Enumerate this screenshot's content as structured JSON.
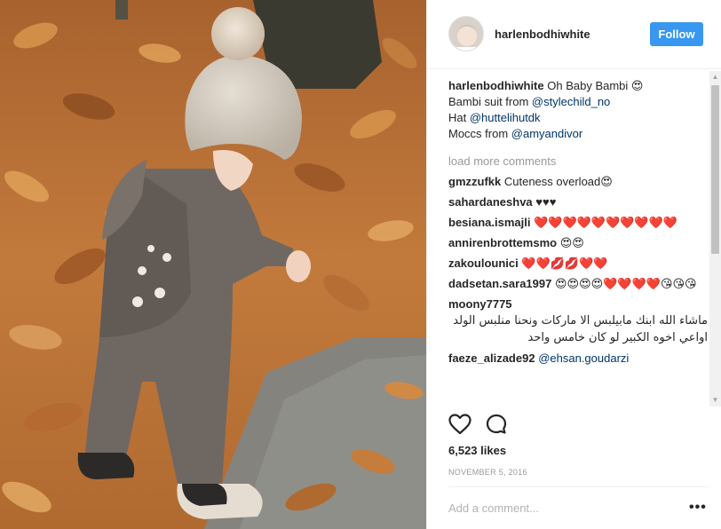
{
  "post": {
    "username": "harlenbodhiwhite",
    "follow_label": "Follow",
    "caption": {
      "user": "harlenbodhiwhite",
      "line1_text": "Oh Baby Bambi 😍",
      "line2_prefix": "Bambi suit from ",
      "line2_mention": "@stylechild_no",
      "line3_prefix": "Hat ",
      "line3_mention": "@huttelihutdk",
      "line4_prefix": "Moccs from ",
      "line4_mention": "@amyandivor"
    },
    "load_more_label": "load more comments",
    "comments": [
      {
        "user": "gmzzufkk",
        "text": "Cuteness overload😍"
      },
      {
        "user": "sahardaneshva",
        "text": "♥♥♥"
      },
      {
        "user": "besiana.ismajli",
        "text": "❤️❤️❤️❤️❤️❤️❤️❤️❤️❤️"
      },
      {
        "user": "annirenbrottemsmo",
        "text": "😍😍"
      },
      {
        "user": "zakoulounici",
        "text": "❤️❤️💋💋❤️❤️"
      },
      {
        "user": "dadsetan.sara1997",
        "text": "😍😍😍😍❤️❤️❤️❤️😘😘😘"
      },
      {
        "user": "moony7775",
        "text": "ماشاء الله ابنك مابيلبس الا ماركات ونحنا منلبس الولد اواعي اخوه الكبير لو كان خامس واحد"
      },
      {
        "user": "faeze_alizade92",
        "mention": "@ehsan.goudarzi"
      }
    ],
    "likes_label": "6,523 likes",
    "date_label": "NOVEMBER 5, 2016",
    "add_comment_placeholder": "Add a comment...",
    "more_label": "•••"
  },
  "icons": {
    "like": "heart-icon",
    "comment": "comment-bubble-icon",
    "scroll_up": "scroll-up-arrow-icon",
    "scroll_down": "scroll-down-arrow-icon"
  },
  "colors": {
    "follow_button": "#3897f0",
    "mention": "#003569",
    "muted": "#999999"
  }
}
